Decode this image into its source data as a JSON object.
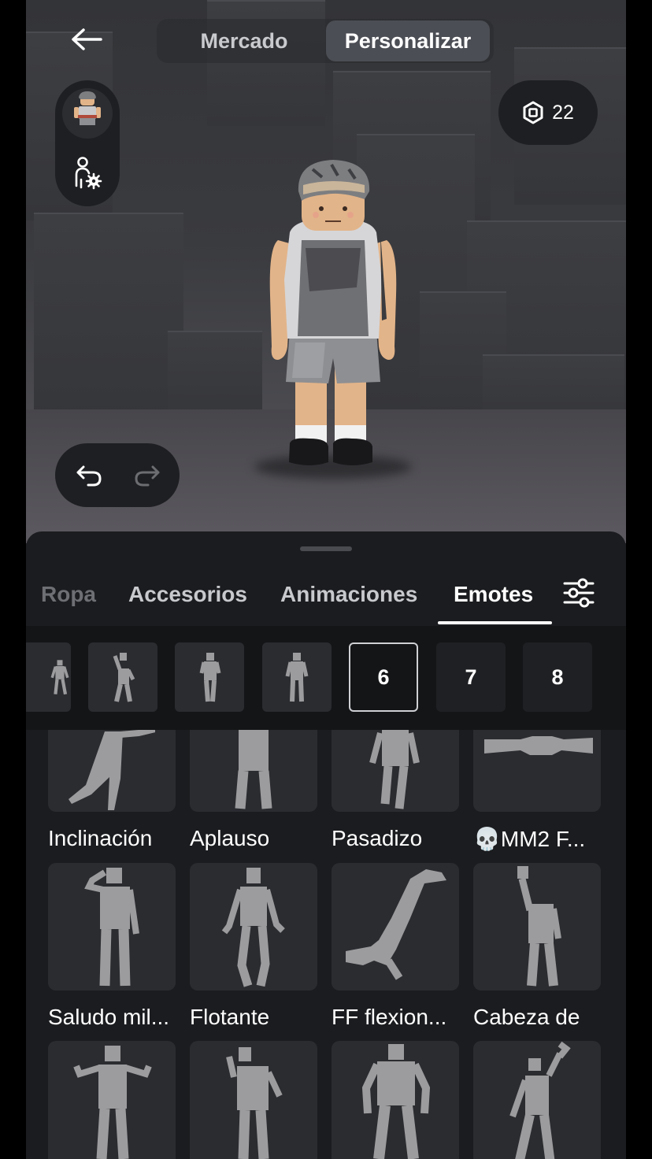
{
  "header": {
    "back_icon": "arrow-left-icon",
    "tabs": [
      {
        "label": "Mercado",
        "active": false
      },
      {
        "label": "Personalizar",
        "active": true
      }
    ]
  },
  "sidebar": {
    "avatar_icon": "avatar-thumbnail",
    "settings_icon": "avatar-settings-icon"
  },
  "robux": {
    "icon": "robux-icon",
    "amount": "22"
  },
  "history": {
    "undo_icon": "undo-icon",
    "redo_icon": "redo-icon"
  },
  "categories": {
    "tabs": [
      "Ropa",
      "Accesorios",
      "Animaciones",
      "Emotes"
    ],
    "active": "Emotes",
    "filter_icon": "filter-sliders-icon"
  },
  "emote_slots": [
    {
      "label": "",
      "filled": true
    },
    {
      "label": "",
      "filled": true
    },
    {
      "label": "",
      "filled": true
    },
    {
      "label": "",
      "filled": true
    },
    {
      "label": "6",
      "filled": false,
      "selected": true
    },
    {
      "label": "7",
      "filled": false
    },
    {
      "label": "8",
      "filled": false
    }
  ],
  "emotes": [
    {
      "name": "Inclinación"
    },
    {
      "name": "Aplauso"
    },
    {
      "name": "Pasadizo"
    },
    {
      "name": "💀MM2 F..."
    },
    {
      "name": "Saludo mil..."
    },
    {
      "name": "Flotante"
    },
    {
      "name": "FF flexion..."
    },
    {
      "name": "Cabeza de"
    },
    {
      "name": ""
    },
    {
      "name": ""
    },
    {
      "name": ""
    },
    {
      "name": ""
    }
  ],
  "colors": {
    "background": "#1b1c1f",
    "panel": "#1e1f22",
    "tile": "#2b2c30",
    "figure": "#9c9c9e",
    "active_tab": "#4c4e55"
  }
}
